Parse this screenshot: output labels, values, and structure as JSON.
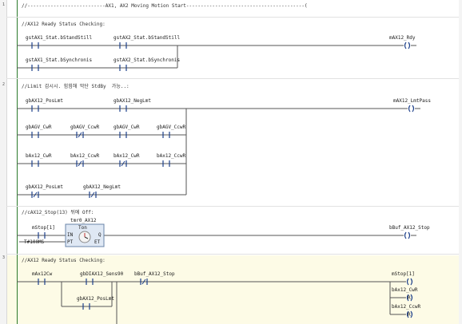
{
  "sections": [
    {
      "id": "s1",
      "marker": "1",
      "comment": "//---------------------------AX1, AX2 Moving Motion Start-----------------------------------------("
    },
    {
      "id": "s2",
      "marker": "",
      "comment": "//AX12 Ready Status Checking:"
    },
    {
      "id": "s3",
      "marker": "2",
      "comment": "//Limit 감시시. 힘힘해 막단 StdBy  가능..:"
    },
    {
      "id": "s4",
      "marker": "",
      "comment": "//cAX12_Stop(13) 뒤에 Off:"
    },
    {
      "id": "s5",
      "marker": "3",
      "comment": "//AX12 Ready Status Checking:"
    }
  ],
  "rung_ready": {
    "contacts": [
      "gstAX1_Stat.bStandStill",
      "gstAX2_Stat.bStandStill",
      "gstAX1_Stat.bSynchronis",
      "gstAX2_Stat.bSynchronis"
    ],
    "coil": "mAX12_Rdy"
  },
  "rung_limit": {
    "contacts": [
      "gbAX12_PosLmt",
      "gbAX12_NegLmt",
      "gbAGV_CwR",
      "gbAGV_CcwR",
      "gbAGV_CwR",
      "gbAGV_CcwR",
      "bAx12_CwR",
      "bAx12_CcwR",
      "bAx12_CwR",
      "bAx12_CcwR",
      "gbAX12_PosLmt",
      "gbAX12_NegLmt"
    ],
    "coil": "mAX12_LmtPass"
  },
  "rung_stop": {
    "contact": "mStop[1]",
    "timer_instance": "tmr0_AX12",
    "timer_type": "Ton",
    "pin_in": "IN",
    "pin_pt": "PT",
    "pin_q": "Q",
    "pin_et": "ET",
    "pt_value": "T#100MS",
    "coil": "bBuf_AX12_Stop"
  },
  "rung_status": {
    "contacts": [
      "mAx12Cw",
      "gbDIAX12_Sens90",
      "bBuf_AX12_Stop",
      "gbAX12_PosLmt"
    ],
    "coils": [
      "mStop[1]",
      "bAx12_CwR",
      "bAx12_CcwR"
    ],
    "coil_marks": [
      "",
      "R",
      "R"
    ]
  },
  "colors": {
    "highlight": "#fdfbe6",
    "rail": "#2b7a2b",
    "wire": "#555555",
    "contact": "#1c3f8a"
  }
}
